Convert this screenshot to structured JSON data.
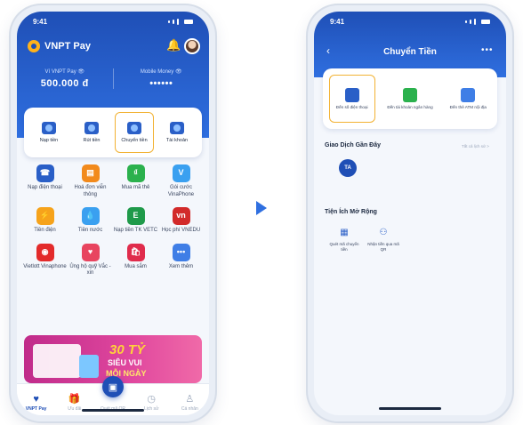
{
  "left": {
    "status": {
      "time": "9:41"
    },
    "brand": "VNPT Pay",
    "wallets": [
      {
        "label": "Ví VNPT Pay 👁",
        "amount": "500.000 đ"
      },
      {
        "label": "Mobile Money 👁",
        "amount": "••••••"
      }
    ],
    "quick_actions": [
      "Nạp tiền",
      "Rút tiền",
      "Chuyển tiền",
      "Tài khoản"
    ],
    "services": [
      {
        "label": "Nạp điện thoại",
        "color": "#2a5fc7",
        "glyph": "☎"
      },
      {
        "label": "Hoá đơn viễn thông",
        "color": "#f28a1c",
        "glyph": "▤"
      },
      {
        "label": "Mua mã thẻ",
        "color": "#2bb14d",
        "glyph": "₫"
      },
      {
        "label": "Gói cước VinaPhone",
        "color": "#3aa0f0",
        "glyph": "V"
      },
      {
        "label": "Tiền điện",
        "color": "#f6a31b",
        "glyph": "⚡"
      },
      {
        "label": "Tiền nước",
        "color": "#3aa0f0",
        "glyph": "💧"
      },
      {
        "label": "Nạp tiền TK VETC",
        "color": "#1f9a4a",
        "glyph": "E"
      },
      {
        "label": "Học phí VNEDU",
        "color": "#d22a2a",
        "glyph": "vn"
      },
      {
        "label": "Vietlott Vinaphone",
        "color": "#e32b2b",
        "glyph": "◉"
      },
      {
        "label": "Ủng hộ quỹ Vắc - xin",
        "color": "#e8445f",
        "glyph": "♥"
      },
      {
        "label": "Mua sắm",
        "color": "#e02c4c",
        "glyph": "🛍"
      },
      {
        "label": "Xem thêm",
        "color": "#3f7ee6",
        "glyph": "•••"
      }
    ],
    "banner": {
      "line1": "30 TỶ",
      "line2": "SIÊU VUI",
      "line3": "MỖI NGÀY"
    },
    "tabs": [
      "VNPT Pay",
      "Ưu đãi",
      "Quét mã QR",
      "Lịch sử",
      "Cá nhân"
    ]
  },
  "right": {
    "status": {
      "time": "9:41"
    },
    "title": "Chuyển Tiền",
    "options": [
      {
        "label": "Đến số điện thoại",
        "color": "#2a5fc7"
      },
      {
        "label": "Đến tài khoản ngân hàng",
        "color": "#2bb14d"
      },
      {
        "label": "Đến thẻ ATM nội địa",
        "color": "#3f7ee6"
      }
    ],
    "recent_title": "Giao Dịch Gần Đây",
    "see_all": "Tất cả lịch sử >",
    "recent_avatar": "TA",
    "utilities_title": "Tiện Ích Mở Rộng",
    "utilities": [
      "Quét mã chuyển tiền",
      "Nhận tiền qua mã QR"
    ]
  }
}
